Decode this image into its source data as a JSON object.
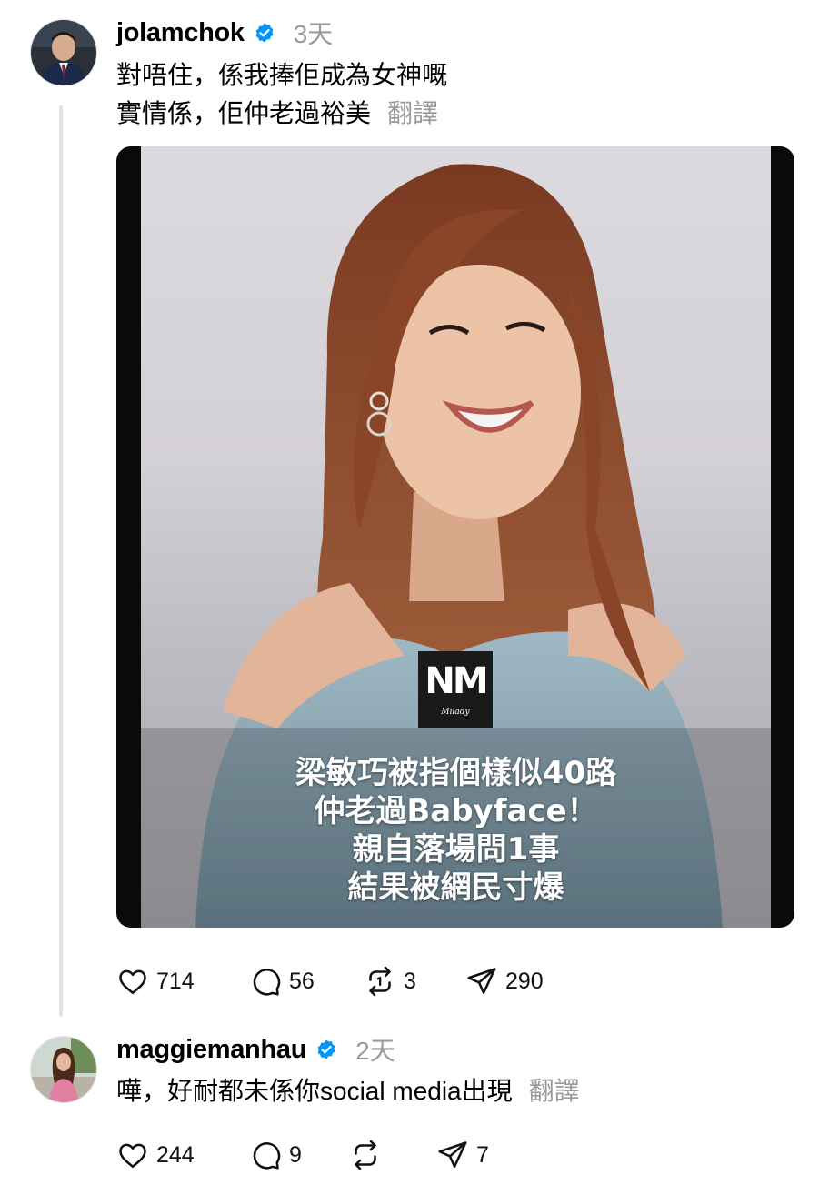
{
  "posts": [
    {
      "username": "jolamchok",
      "time": "3天",
      "lines": [
        "對唔住，係我捧佢成為女神嘅",
        "實情係，佢仲老過裕美"
      ],
      "translate": "翻譯",
      "media": {
        "logo_text": "NM",
        "logo_sub": "Milady",
        "headline": [
          "梁敏巧被指個樣似40路",
          "仲老過Babyface！",
          "親自落場問1事",
          "結果被網民寸爆"
        ]
      },
      "stats": {
        "likes": "714",
        "comments": "56",
        "reposts": "3",
        "shares": "290"
      }
    },
    {
      "username": "maggiemanhau",
      "time": "2天",
      "lines": [
        "嘩，好耐都未係你social media出現"
      ],
      "translate": "翻譯",
      "stats": {
        "likes": "244",
        "comments": "9",
        "reposts": "",
        "shares": "7"
      }
    }
  ],
  "colors": {
    "verified": "#0095f6",
    "muted": "#9a9a9a",
    "thread_line": "#e3e3e3"
  },
  "icons": [
    "heart-icon",
    "comment-icon",
    "repost-icon",
    "share-icon",
    "verified-badge-icon"
  ]
}
